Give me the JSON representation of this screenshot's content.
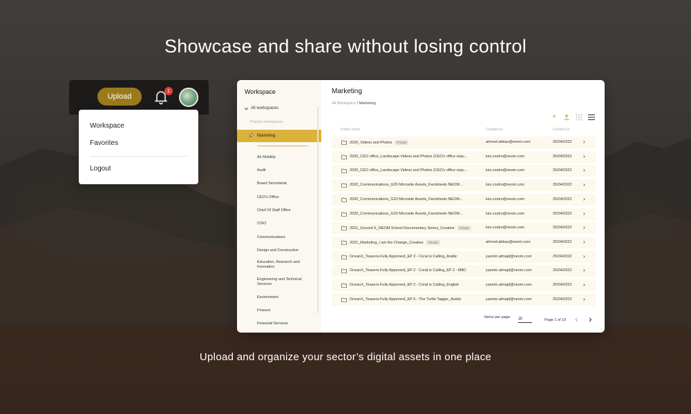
{
  "headline": "Showcase and share without losing control",
  "subline": "Upload and organize your sector’s digital assets in one place",
  "topbar": {
    "upload_label": "Upload",
    "notification_count": "1"
  },
  "user_menu": {
    "items": [
      "Workspace",
      "Favorites",
      "Logout"
    ]
  },
  "sidebar": {
    "title": "Workspace",
    "all_workspaces": "All workspaces",
    "pinned_label": "Pinned workspaces",
    "active_item": "Marketing",
    "items": [
      "Air Mobility",
      "Audit",
      "Board Secretariat",
      "CEO's Office",
      "Chief Of Staff Office",
      "CISO",
      "Communications",
      "Design and Construction",
      "Education, Research and Innovation",
      "Engineering and Technical Services",
      "Environment",
      "Finance",
      "Financial Services"
    ]
  },
  "main": {
    "title": "Marketing",
    "breadcrumb_root": "All Workspace",
    "breadcrumb_current": "/ Marketing",
    "columns": [
      "Folder name",
      "Created by",
      "Created on"
    ],
    "rows": [
      {
        "name": "2020_Videos and Photos",
        "badge": "Private",
        "by": "ahmed.abbas@neom.com",
        "on": "25/04/2022"
      },
      {
        "name": "2020_CEO office_Landscape Videos and Photos (CEO's office requ...",
        "badge": "",
        "by": "luis.costro@neom.com",
        "on": "25/04/2022"
      },
      {
        "name": "2020_CEO office_Landscape Videos and Photos (CEO's office requ...",
        "badge": "",
        "by": "luis.costro@neom.com",
        "on": "25/04/2022"
      },
      {
        "name": "2020_Communications_G20 Microsite Assets_Factsheets NEOM...",
        "badge": "",
        "by": "luis.costro@neom.com",
        "on": "25/04/2022"
      },
      {
        "name": "2020_Communications_G20 Microsite Assets_Factsheets NEOM...",
        "badge": "",
        "by": "luis.costro@neom.com",
        "on": "25/04/2022"
      },
      {
        "name": "2020_Communications_G20 Microsite Assets_Factsheets NEOM...",
        "badge": "",
        "by": "luis.costro@neom.com",
        "on": "25/04/2022"
      },
      {
        "name": "2021_Ground X_NEOM School Documentary Series_Creative",
        "badge": "Private",
        "by": "luis.costro@neom.com",
        "on": "25/04/2022"
      },
      {
        "name": "2021_Marketing_I am the Change_Creative",
        "badge": "Private",
        "by": "ahmed.abbas@neom.com",
        "on": "25/04/2022"
      },
      {
        "name": "OceanX_Teasers-Fully Approved_EP 2 - Coral is Calling_Arabic",
        "badge": "",
        "by": "yasmin.almajd@neom.com",
        "on": "25/04/2022"
      },
      {
        "name": "OceanX_Teasers-Fully Approved_EP 2 - Coral is Calling_EP 2 - MBC",
        "badge": "",
        "by": "yasmin.almajd@neom.com",
        "on": "25/04/2022"
      },
      {
        "name": "OceanX_Teasers-Fully Approved_EP 2 - Coral is Calling_English",
        "badge": "",
        "by": "yasmin.almajd@neom.com",
        "on": "25/04/2022"
      },
      {
        "name": "OceanX_Teasers-Fully Approved_EP 5 - The Turtle Tagger_Arabic",
        "badge": "",
        "by": "yasmin.almajd@neom.com",
        "on": "25/04/2022"
      }
    ],
    "pager": {
      "items_per_page_label": "Items per page:",
      "items_per_page_value": "20",
      "page_of": "Page 1 of 10"
    }
  },
  "colors": {
    "accent": "#dcb23a",
    "upload_button": "#9a7a1a",
    "row_background": "#fcf8ec",
    "badge_red": "#e0403b"
  },
  "icons": [
    "bell-icon",
    "avatar",
    "pin-icon",
    "folder-icon",
    "chevron-right-icon",
    "add-icon",
    "upload-icon",
    "grid-view-icon",
    "list-view-icon"
  ]
}
